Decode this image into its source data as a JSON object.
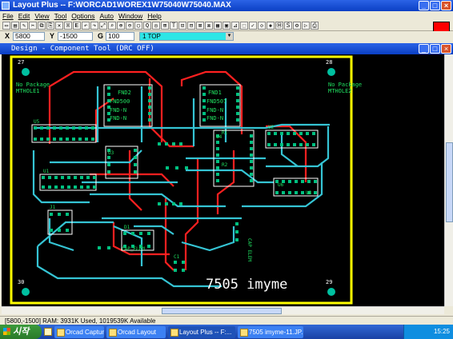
{
  "app": {
    "title": "Layout Plus -- F:WORCAD1WOREX1W75040W75040.MAX",
    "menu": [
      "File",
      "Edit",
      "View",
      "Tool",
      "Options",
      "Auto",
      "Window",
      "Help"
    ]
  },
  "coords": {
    "x_label": "X",
    "x_value": "5800",
    "y_label": "Y",
    "y_value": "-1500",
    "g_label": "G",
    "g_value": "100",
    "layer": "1 TOP"
  },
  "child": {
    "title": "Design - Component Tool (DRC OFF)"
  },
  "board": {
    "corners": [
      "27",
      "28",
      "30",
      "29"
    ],
    "no_package_left": "No Package",
    "mthole_left": "MTHOLE1",
    "no_package_right": "No Package",
    "mthole_right": "MTHOLE2",
    "fnd2_labels": [
      "FND2",
      "FND500",
      "FND-N",
      "FND-N"
    ],
    "fnd1_labels": [
      "FND1",
      "FND507",
      "FND-N",
      "FND-N"
    ],
    "ref_labels": [
      "U5",
      "U3",
      "U4",
      "U1",
      "U2",
      "U6",
      "U8",
      "D1",
      "J1",
      "C1",
      "R1",
      "R2"
    ],
    "cap_left": "CAP_ELEM",
    "cap_right": "CAP ELEM",
    "signature": "7505 imyme"
  },
  "status": {
    "text": "[5800,-1500]   RAM: 3931K Used, 1019539K Available"
  },
  "taskbar": {
    "start": "시작",
    "tasks": [
      "Orcad Capture",
      "Orcad Layout",
      "Layout Plus -- F:...",
      "7505 imyme-11.JP..."
    ],
    "clock": "15:25"
  },
  "colors": {
    "trace_cyan": "#35c4d4",
    "trace_red": "#ff2020",
    "silk_white": "#ffffff",
    "board_outline": "#ffff00",
    "pad_green": "#00c080",
    "text_green": "#20e060"
  }
}
